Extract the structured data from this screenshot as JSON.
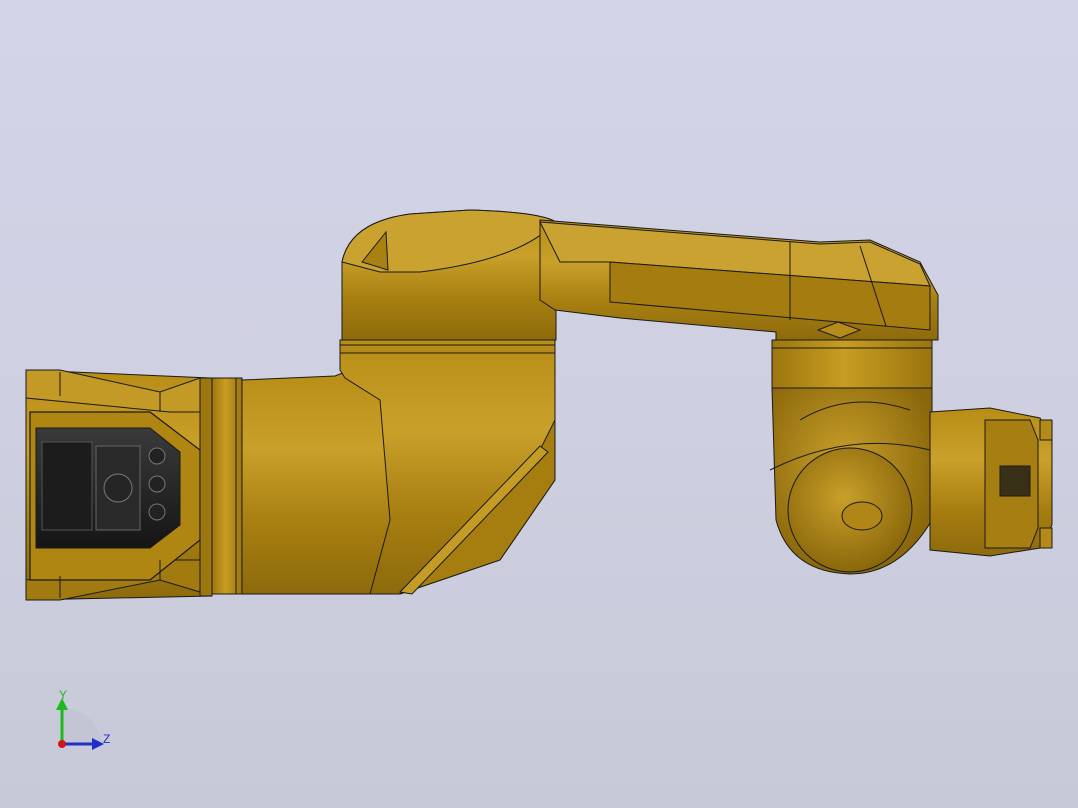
{
  "viewport": {
    "name": "cad-graphics-area",
    "background": "#d0d1e4",
    "model_color": "#c99a1e",
    "edge_color": "#1a1a1a",
    "display_mode": "shaded-with-edges"
  },
  "triad": {
    "y_label": "Y",
    "z_label": "Z",
    "y_color": "#1fb81f",
    "z_color": "#1f2fc8",
    "x_color": "#d01818"
  }
}
